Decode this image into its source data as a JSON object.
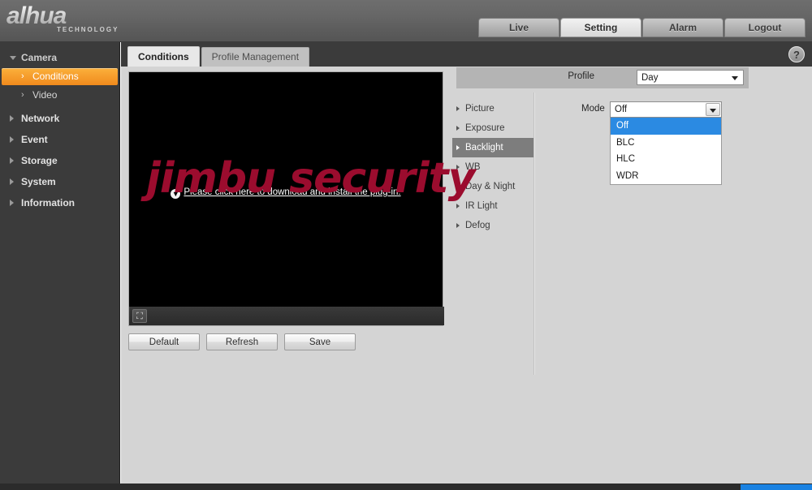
{
  "brand": {
    "name": "alhua",
    "tagline": "TECHNOLOGY"
  },
  "topnav": {
    "items": [
      {
        "label": "Live",
        "active": false
      },
      {
        "label": "Setting",
        "active": true
      },
      {
        "label": "Alarm",
        "active": false
      },
      {
        "label": "Logout",
        "active": false
      }
    ]
  },
  "sidebar": {
    "groups": [
      {
        "label": "Camera",
        "expanded": true,
        "icon": "triangle-down-icon"
      },
      {
        "label": "Network",
        "expanded": false,
        "icon": "triangle-right-icon"
      },
      {
        "label": "Event",
        "expanded": false,
        "icon": "triangle-right-icon"
      },
      {
        "label": "Storage",
        "expanded": false,
        "icon": "triangle-right-icon"
      },
      {
        "label": "System",
        "expanded": false,
        "icon": "triangle-right-icon"
      },
      {
        "label": "Information",
        "expanded": false,
        "icon": "triangle-right-icon"
      }
    ],
    "camera_children": [
      {
        "label": "Conditions",
        "selected": true
      },
      {
        "label": "Video",
        "selected": false
      }
    ]
  },
  "content": {
    "help_icon": "question-mark-icon",
    "tabs": [
      {
        "label": "Conditions",
        "active": true
      },
      {
        "label": "Profile Management",
        "active": false
      }
    ]
  },
  "video": {
    "plugin_prompt": "Please click here to download and install the plug-in.",
    "download_icon": "download-arrow-icon",
    "fullscreen_icon": "fullscreen-icon"
  },
  "buttons": [
    {
      "label": "Default"
    },
    {
      "label": "Refresh"
    },
    {
      "label": "Save"
    }
  ],
  "submenu": {
    "items": [
      {
        "label": "Picture",
        "selected": false
      },
      {
        "label": "Exposure",
        "selected": false
      },
      {
        "label": "Backlight",
        "selected": true
      },
      {
        "label": "WB",
        "selected": false
      },
      {
        "label": "Day & Night",
        "selected": false
      },
      {
        "label": "IR Light",
        "selected": false
      },
      {
        "label": "Defog",
        "selected": false
      }
    ]
  },
  "profile": {
    "label": "Profile",
    "value": "Day",
    "dropdown_icon": "chevron-down-icon"
  },
  "mode": {
    "label": "Mode",
    "value": "Off",
    "dropdown_icon": "chevron-down-icon",
    "open": true,
    "options": [
      {
        "label": "Off",
        "highlighted": true
      },
      {
        "label": "BLC",
        "highlighted": false
      },
      {
        "label": "HLC",
        "highlighted": false
      },
      {
        "label": "WDR",
        "highlighted": false
      }
    ]
  },
  "watermark": {
    "text": "jimbu security",
    "color": "#9b0c2e"
  },
  "colors": {
    "accent_orange": "#f08a1d",
    "selection_blue": "#2b8ae2",
    "panel_gray": "#d4d4d4",
    "dark_chrome": "#3b3b3b"
  }
}
